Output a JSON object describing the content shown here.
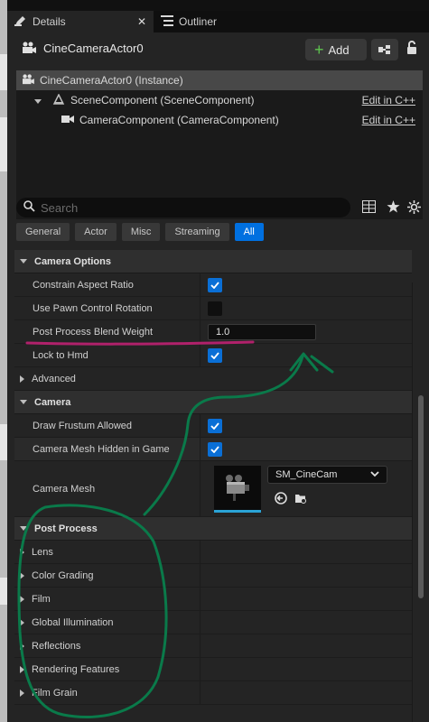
{
  "tabs": [
    {
      "label": "Details",
      "active": true
    },
    {
      "label": "Outliner",
      "active": false
    }
  ],
  "header": {
    "title": "CineCameraActor0",
    "add_label": "Add"
  },
  "tree": {
    "items": [
      {
        "label": "CineCameraActor0 (Instance)",
        "selected": true
      },
      {
        "label": "SceneComponent (SceneComponent)",
        "edit": "Edit in C++"
      },
      {
        "label": "CameraComponent (CameraComponent)",
        "edit": "Edit in C++"
      }
    ]
  },
  "search": {
    "placeholder": "Search"
  },
  "filters": [
    "General",
    "Actor",
    "Misc",
    "Streaming",
    "All"
  ],
  "active_filter": "All",
  "sections": {
    "camera_options": {
      "title": "Camera Options",
      "rows": [
        {
          "label": "Constrain Aspect Ratio",
          "checked": true
        },
        {
          "label": "Use Pawn Control Rotation",
          "checked": false
        },
        {
          "label": "Post Process Blend Weight",
          "value": "1.0"
        },
        {
          "label": "Lock to Hmd",
          "checked": true
        }
      ],
      "advanced": "Advanced"
    },
    "camera": {
      "title": "Camera",
      "rows": [
        {
          "label": "Draw Frustum Allowed",
          "checked": true
        },
        {
          "label": "Camera Mesh Hidden in Game",
          "checked": true
        }
      ],
      "mesh_label": "Camera Mesh",
      "mesh_value": "SM_CineCam"
    },
    "post_process": {
      "title": "Post Process",
      "items": [
        "Lens",
        "Color Grading",
        "Film",
        "Global Illumination",
        "Reflections",
        "Rendering Features",
        "Film Grain"
      ]
    }
  },
  "colors": {
    "accent": "#0070e0",
    "annotation_green": "#0a7a4a",
    "annotation_magenta": "#b0216b"
  }
}
